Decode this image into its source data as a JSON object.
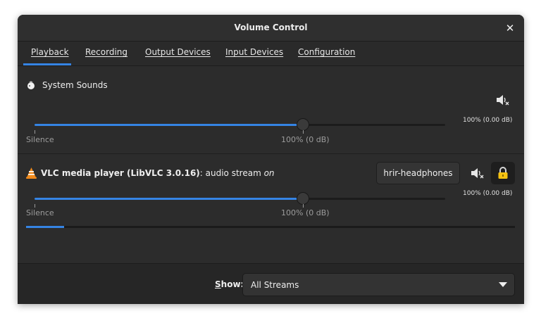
{
  "window": {
    "title": "Volume Control",
    "close_glyph": "✕"
  },
  "tabs": [
    {
      "label": "Playback",
      "active": true
    },
    {
      "label": "Recording"
    },
    {
      "label": "Output Devices"
    },
    {
      "label": "Input Devices"
    },
    {
      "label": "Configuration"
    }
  ],
  "streams": [
    {
      "icon": "system-sounds-icon",
      "name": "System Sounds",
      "mute_icon": "speaker-muted-icon",
      "volume_fraction": 1.0,
      "percent_label": "100% (0.00 dB)",
      "silence_label": "Silence",
      "center_label": "100% (0 dB)"
    },
    {
      "icon": "vlc-icon",
      "app_name": "VLC media player (LibVLC 3.0.16)",
      "separator_text": ": audio stream ",
      "state_text": "on",
      "device_label": "hrir-headphones",
      "mute_icon": "speaker-muted-icon",
      "lock_icon": "lock-icon",
      "volume_fraction": 1.0,
      "percent_label": "100% (0.00 dB)",
      "silence_label": "Silence",
      "center_label": "100% (0 dB)",
      "level_fraction": 0.08
    }
  ],
  "footer": {
    "show_label_prefix": "S",
    "show_label_rest": "how:",
    "dropdown_value": "All Streams"
  },
  "colors": {
    "accent": "#3584e4",
    "background": "#2c2c2c",
    "lock": "#f5c211"
  }
}
